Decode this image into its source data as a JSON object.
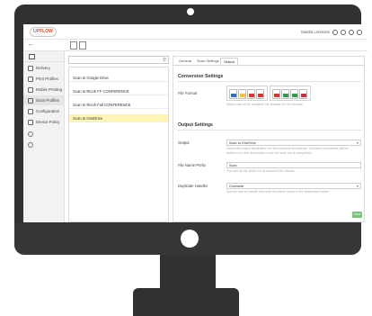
{
  "app": {
    "logo_prefix": "UP",
    "logo_main": "FLOW",
    "user_name": "Sandra Lorenzen",
    "icons": [
      "user-icon",
      "bell-icon",
      "help-icon",
      "logout-icon"
    ]
  },
  "sidebar": {
    "items": [
      {
        "label": "Delivery",
        "icon": "list-icon"
      },
      {
        "label": "Print Profiles",
        "icon": "printer-icon"
      },
      {
        "label": "Mobile Printing",
        "icon": "mobile-icon"
      },
      {
        "label": "Scan Profiles",
        "icon": "scan-icon"
      },
      {
        "label": "Configuration",
        "icon": "gear-icon"
      },
      {
        "label": "Device Policy",
        "icon": "policy-icon"
      }
    ]
  },
  "list": {
    "search_placeholder": "",
    "rows": [
      "Scan to Google Drive",
      "Scan to Ricoh FF CONFERENCE",
      "Scan to Ricoh Full CONFERENCE",
      "Scan to OneDrive"
    ],
    "selected_index": 3
  },
  "detail": {
    "tabs": [
      "General",
      "Scan Settings",
      "Output"
    ],
    "active_tab": 2,
    "conversion": {
      "title": "Conversion Settings",
      "file_format_label": "File Format",
      "file_format_help": "Select one of the available file formats for file formats.",
      "formats": [
        {
          "name": "pdf",
          "color": "#2f6fbf"
        },
        {
          "name": "doc",
          "color": "#f2c230"
        },
        {
          "name": "pdf",
          "color": "#d9362b"
        },
        {
          "name": "tif",
          "color": "#d9362b"
        },
        {
          "name": "jpg",
          "color": "#d9362b"
        },
        {
          "name": "xls",
          "color": "#2e9b4a"
        },
        {
          "name": "txt",
          "color": "#2e9b4a"
        },
        {
          "name": "png",
          "color": "#c9303b"
        }
      ]
    },
    "output": {
      "title": "Output Settings",
      "output_label": "Output",
      "output_value": "Scan to OneDrive",
      "output_help": "Select the output destination for the scanned documents. Scanned documents will be delivered to this destination once the scan job is completed.",
      "prefix_label": "File Name Prefix",
      "prefix_value": "Scan",
      "prefix_help": "This will be the prefix for all scanned file names.",
      "dup_label": "Duplicate Handler",
      "dup_value": "Overwrite",
      "dup_help": "Specify how to handle files with the same name in the destination folder."
    },
    "save_label": "Save"
  },
  "colors": {
    "accent": "#e2501f",
    "selected_row": "#fff5b5",
    "save": "#7ac47a",
    "bezel": "#2f3133"
  }
}
